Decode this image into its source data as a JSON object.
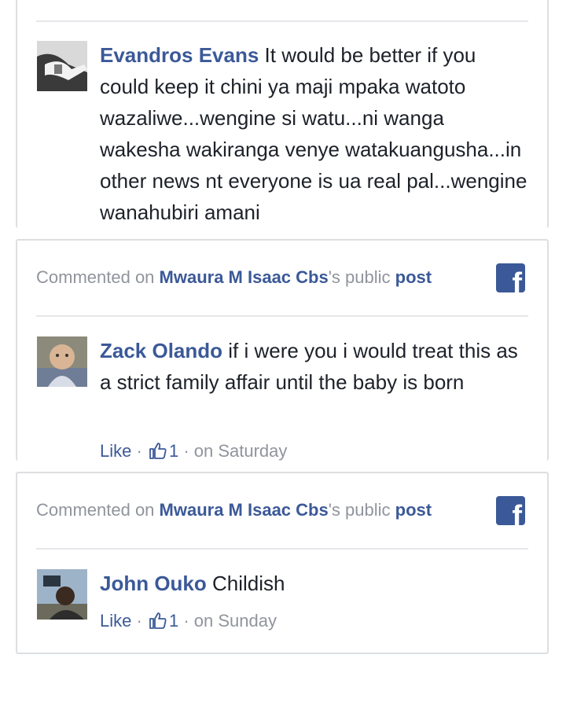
{
  "comments": [
    {
      "author": "Evandros Evans",
      "text": "It would be better if you could keep it chini ya maji mpaka watoto wazaliwe...wengine si watu...ni wanga wakesha wakiranga venye watakuangusha...in other news nt everyone is ua real pal...wengine wanahubiri amani"
    },
    {
      "header": {
        "prefix": "Commented on ",
        "page": "Mwaura M Isaac Cbs",
        "suffix": "'s public ",
        "post_link": "post"
      },
      "author": "Zack Olando",
      "text": "if i were you i would treat this as a strict family affair until the baby is born",
      "like_label": "Like",
      "sep": "·",
      "like_count": "1",
      "time": "on Saturday"
    },
    {
      "header": {
        "prefix": "Commented on ",
        "page": "Mwaura M Isaac Cbs",
        "suffix": "'s public ",
        "post_link": "post"
      },
      "author": "John Ouko",
      "text": "Childish",
      "like_label": "Like",
      "sep": "·",
      "like_count": "1",
      "time": "on Sunday"
    }
  ],
  "icons": {
    "facebook": "facebook-f-icon",
    "like": "thumbs-up-icon"
  },
  "colors": {
    "link": "#3b5998",
    "meta": "#90949c",
    "text": "#1d2129",
    "border": "#dddfe2"
  }
}
